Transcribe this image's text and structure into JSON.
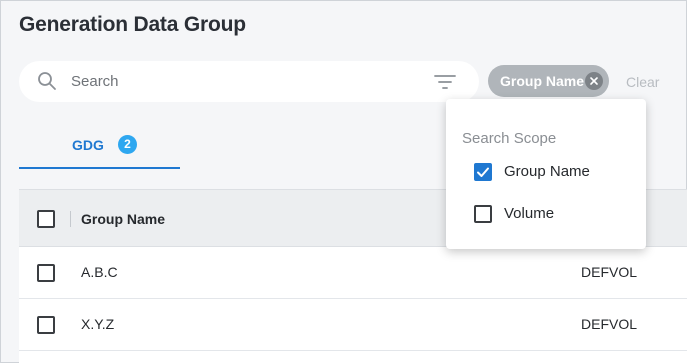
{
  "page": {
    "title": "Generation Data Group"
  },
  "search": {
    "placeholder": "Search",
    "value": "",
    "filter_icon": "filter-icon",
    "search_icon": "search-icon"
  },
  "chip": {
    "label": "Group Name",
    "close_icon": "close-icon"
  },
  "clear_label": "Clear",
  "tabs": [
    {
      "label": "GDG",
      "count": "2",
      "active": true
    }
  ],
  "table": {
    "columns": [
      {
        "label": "Group Name"
      }
    ],
    "rows": [
      {
        "name": "A.B.C",
        "volume": "DEFVOL",
        "checked": false
      },
      {
        "name": "X.Y.Z",
        "volume": "DEFVOL",
        "checked": false
      }
    ]
  },
  "search_scope": {
    "title": "Search Scope",
    "options": [
      {
        "label": "Group Name",
        "checked": true
      },
      {
        "label": "Volume",
        "checked": false
      }
    ]
  },
  "colors": {
    "accent": "#1f78d1",
    "badge": "#2ea7f0",
    "chip": "#b0b5ba",
    "background": "#f5f6f8"
  }
}
